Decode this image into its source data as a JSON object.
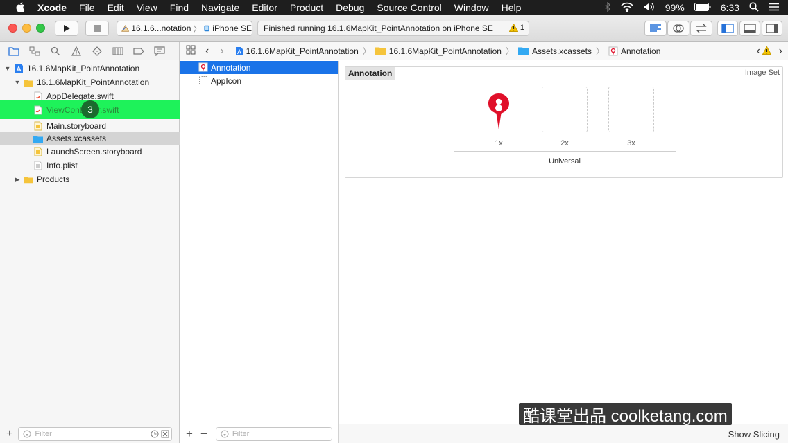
{
  "menubar": {
    "app": "Xcode",
    "items": [
      "File",
      "Edit",
      "View",
      "Find",
      "Navigate",
      "Editor",
      "Product",
      "Debug",
      "Source Control",
      "Window",
      "Help"
    ],
    "battery": "99%",
    "time": "6:33"
  },
  "toolbar": {
    "scheme": "16.1.6...notation",
    "device": "iPhone SE",
    "activity": "Finished running 16.1.6MapKit_PointAnnotation on iPhone SE",
    "warning_count": "1"
  },
  "navigator": {
    "project": "16.1.6MapKit_PointAnnotation",
    "group": "16.1.6MapKit_PointAnnotation",
    "files": [
      "AppDelegate.swift",
      "ViewController.swift",
      "Main.storyboard",
      "Assets.xcassets",
      "LaunchScreen.storyboard",
      "Info.plist"
    ],
    "products": "Products",
    "step_badge": "3",
    "filter_placeholder": "Filter"
  },
  "jumpbar": {
    "crumbs": [
      "16.1.6MapKit_PointAnnotation",
      "16.1.6MapKit_PointAnnotation",
      "Assets.xcassets",
      "Annotation"
    ]
  },
  "asset_list": {
    "items": [
      "Annotation",
      "AppIcon"
    ],
    "filter_placeholder": "Filter"
  },
  "editor": {
    "set_name": "Annotation",
    "set_type": "Image Set",
    "slots": [
      "1x",
      "2x",
      "3x"
    ],
    "universal": "Universal",
    "show_slicing": "Show Slicing"
  },
  "watermark": "酷课堂出品 coolketang.com",
  "colors": {
    "selection_blue": "#1a73e8",
    "highlight_green": "#1ef25a",
    "pin_red": "#e0102a",
    "folder_yellow": "#f5c43b"
  }
}
